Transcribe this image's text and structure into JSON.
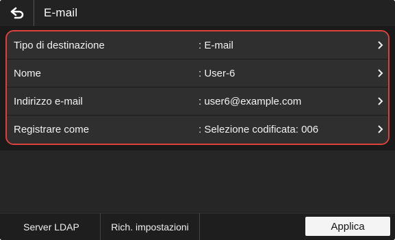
{
  "header": {
    "title": "E-mail",
    "back_icon": "back-arrow-icon"
  },
  "rows": [
    {
      "label": "Tipo di destinazione",
      "value": ": E-mail"
    },
    {
      "label": "Nome",
      "value": ": User-6"
    },
    {
      "label": "Indirizzo e-mail",
      "value": ": user6@example.com"
    },
    {
      "label": "Registrare come",
      "value": ": Selezione codificata: 006"
    }
  ],
  "footer": {
    "ldap_label": "Server LDAP",
    "settings_label": "Rich. impostazioni",
    "apply_label": "Applica"
  },
  "colors": {
    "highlight_border": "#e1413c",
    "background": "#1a1a1a",
    "apply_button": "#f4f4f4"
  }
}
